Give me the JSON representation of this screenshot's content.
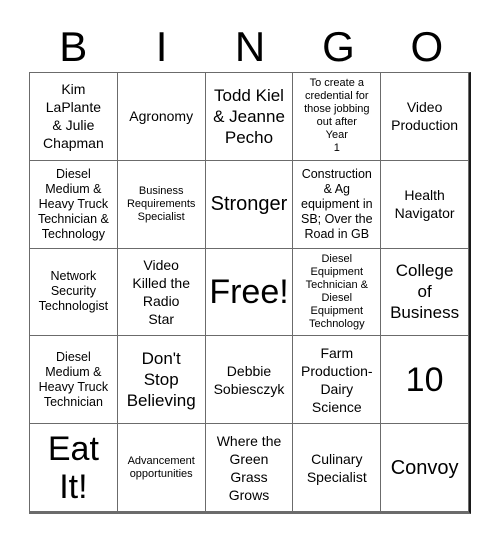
{
  "header": {
    "letters": [
      "B",
      "I",
      "N",
      "G",
      "O"
    ]
  },
  "cells": [
    [
      "Kim\nLaPlante\n& Julie\nChapman",
      "Agronomy",
      "Todd Kiel\n& Jeanne\nPecho",
      "To create a\ncredential for\nthose jobbing\nout after\nYear\n1",
      "Video\nProduction"
    ],
    [
      "Diesel\nMedium &\nHeavy Truck\nTechnician &\nTechnology",
      "Business\nRequirements\nSpecialist",
      "Stronger",
      "Construction\n& Ag\nequipment in\nSB; Over the\nRoad in GB",
      "Health\nNavigator"
    ],
    [
      "Network\nSecurity\nTechnologist",
      "Video\nKilled the\nRadio\nStar",
      "Free!",
      "Diesel\nEquipment\nTechnician &\nDiesel\nEquipment\nTechnology",
      "College\nof\nBusiness"
    ],
    [
      "Diesel\nMedium &\nHeavy Truck\nTechnician",
      "Don't\nStop\nBelieving",
      "Debbie\nSobiesczyk",
      "Farm\nProduction-\nDairy\nScience",
      "10"
    ],
    [
      "Eat\nIt!",
      "Advancement\nopportunities",
      "Where the\nGreen\nGrass\nGrows",
      "Culinary\nSpecialist",
      "Convoy"
    ]
  ]
}
